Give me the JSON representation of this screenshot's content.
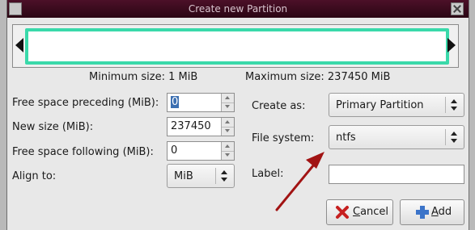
{
  "window": {
    "title": "Create new Partition"
  },
  "sizes": {
    "minimum": "Minimum size: 1 MiB",
    "maximum": "Maximum size: 237450 MiB"
  },
  "left": {
    "free_preceding": {
      "label": "Free space preceding (MiB):",
      "value": "0"
    },
    "new_size": {
      "label": "New size (MiB):",
      "value": "237450"
    },
    "free_following": {
      "label": "Free space following (MiB):",
      "value": "0"
    },
    "align_to": {
      "label": "Align to:",
      "value": "MiB"
    }
  },
  "right": {
    "create_as": {
      "label": "Create as:",
      "value": "Primary Partition"
    },
    "file_system": {
      "label": "File system:",
      "value": "ntfs"
    },
    "partition_label": {
      "label": "Label:",
      "value": ""
    }
  },
  "buttons": {
    "cancel": {
      "mnemonic": "C",
      "rest": "ancel"
    },
    "add": {
      "mnemonic": "A",
      "rest": "dd"
    }
  },
  "colors": {
    "partition_bar": "#3ad9aa",
    "annotation_arrow": "#a11313",
    "cancel_icon": "#c62020",
    "add_icon": "#3b74c9"
  }
}
